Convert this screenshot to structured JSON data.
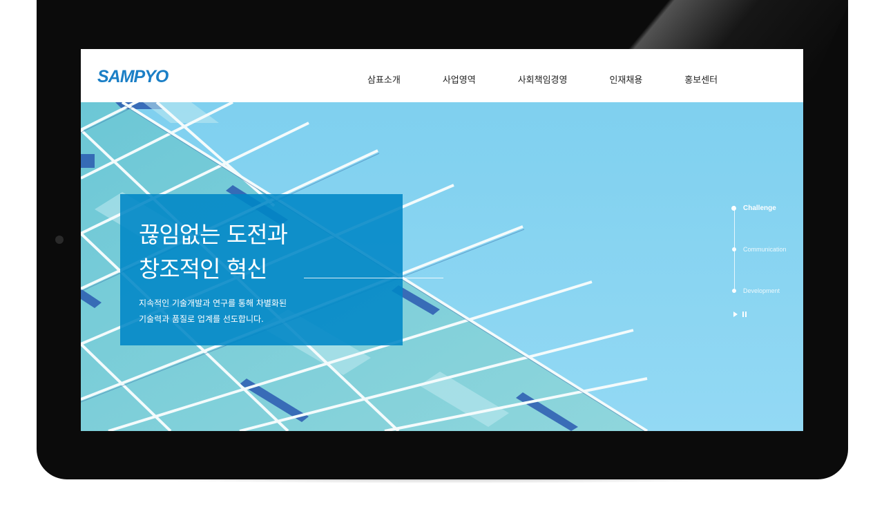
{
  "brand": {
    "logo_text": "SAMPYO",
    "color": "#1b7fc6"
  },
  "nav": {
    "items": [
      {
        "label": "삼표소개"
      },
      {
        "label": "사업영역"
      },
      {
        "label": "사회책임경영"
      },
      {
        "label": "인재채용"
      },
      {
        "label": "홍보센터"
      }
    ]
  },
  "hero": {
    "headline_line1": "끊임없는 도전과",
    "headline_line2": "창조적인 혁신",
    "subtext_line1": "지속적인 기술개발과 연구를 통해 차별화된",
    "subtext_line2": "기술력과 품질로 업계를 선도합니다.",
    "caption_color": "#0086c6",
    "background_color": "#7fd0ee"
  },
  "slides": {
    "items": [
      {
        "label": "Challenge",
        "active": true
      },
      {
        "label": "Communication",
        "active": false
      },
      {
        "label": "Development",
        "active": false
      }
    ],
    "controls": {
      "play_icon": "play-icon",
      "pause_icon": "pause-icon"
    }
  }
}
